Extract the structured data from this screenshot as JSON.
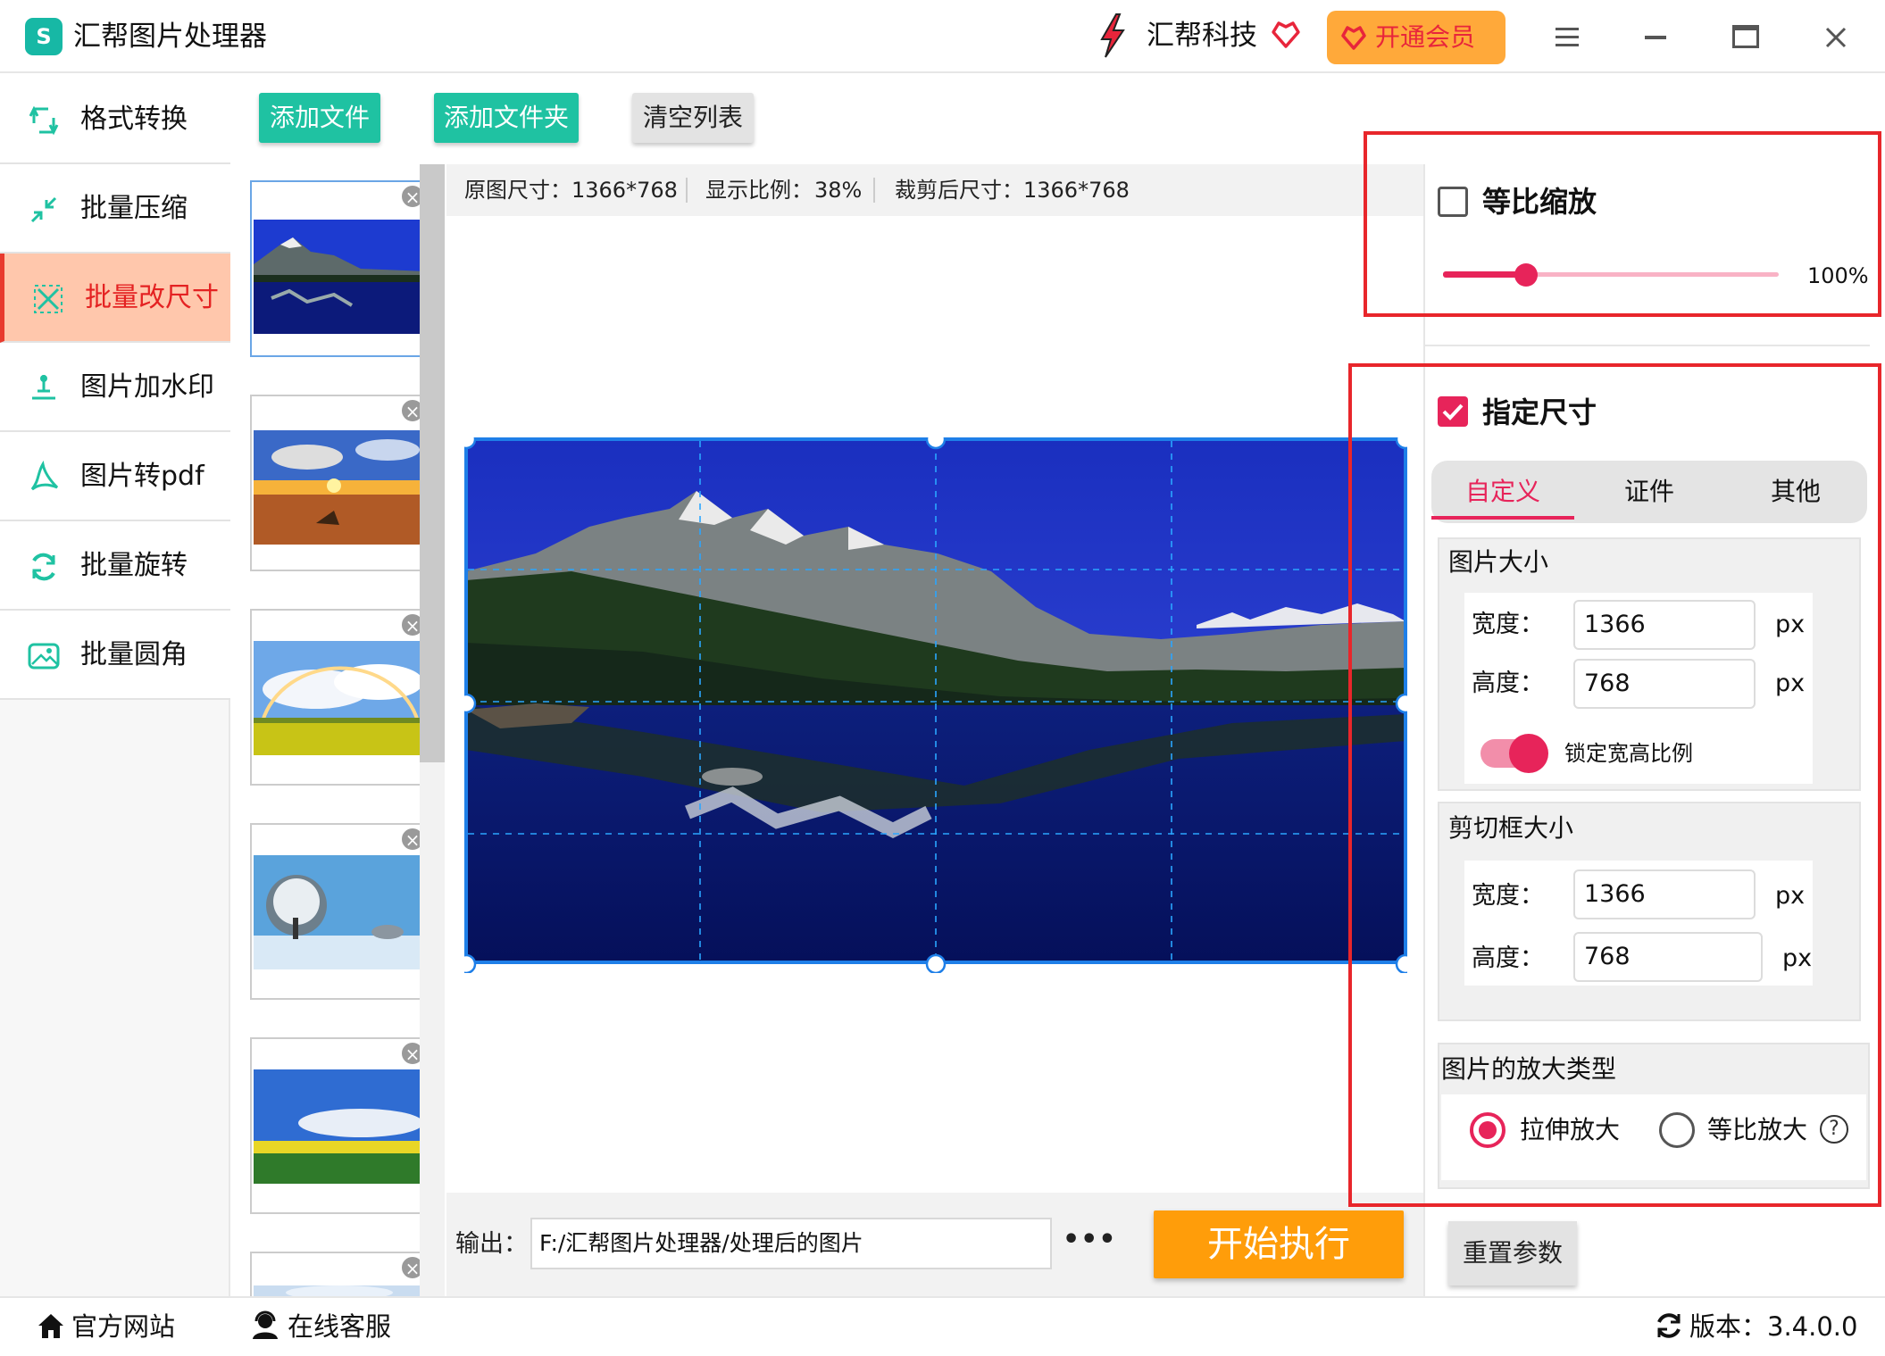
{
  "app": {
    "title": "汇帮图片处理器",
    "logo_text": "S",
    "accent": "#e7245a",
    "green": "#1fc2a2",
    "orange": "#ff9d0a"
  },
  "header": {
    "brand": "汇帮科技",
    "vip_label": "开通会员"
  },
  "sidebar": {
    "items": [
      {
        "label": "格式转换",
        "icon": "format-convert-icon"
      },
      {
        "label": "批量压缩",
        "icon": "compress-icon"
      },
      {
        "label": "批量改尺寸",
        "icon": "resize-icon",
        "active": true
      },
      {
        "label": "图片加水印",
        "icon": "watermark-icon"
      },
      {
        "label": "图片转pdf",
        "icon": "pdf-icon"
      },
      {
        "label": "批量旋转",
        "icon": "rotate-icon"
      },
      {
        "label": "批量圆角",
        "icon": "rounded-corner-icon"
      }
    ]
  },
  "toolbar": {
    "add_file": "添加文件",
    "add_folder": "添加文件夹",
    "clear_list": "清空列表"
  },
  "thumbnails": {
    "remove_glyph": "×",
    "items": [
      {
        "subject": "mountain lake",
        "selected": true
      },
      {
        "subject": "sunset beach"
      },
      {
        "subject": "rainbow over rapeseed field"
      },
      {
        "subject": "snowy trees"
      },
      {
        "subject": "blue sky over yellow field"
      },
      {
        "subject": "sky"
      }
    ]
  },
  "preview": {
    "original_size_label": "原图尺寸：",
    "original_size": "1366*768",
    "display_ratio_label": "显示比例：",
    "display_ratio": "38%",
    "cropped_size_label": "裁剪后尺寸：",
    "cropped_size": "1366*768"
  },
  "output": {
    "label": "输出：",
    "path": "F:/汇帮图片处理器/处理后的图片",
    "more": "•••",
    "start": "开始执行"
  },
  "panel": {
    "proportional": {
      "label": "等比缩放",
      "checked": false,
      "value_label": "100%",
      "value": 0.25
    },
    "specify": {
      "label": "指定尺寸",
      "checked": true
    },
    "tabs": [
      {
        "label": "自定义",
        "active": true
      },
      {
        "label": "证件"
      },
      {
        "label": "其他"
      }
    ],
    "image_size": {
      "title": "图片大小",
      "width_label": "宽度：",
      "width": "1366",
      "height_label": "高度：",
      "height": "768",
      "unit": "px",
      "lock_label": "锁定宽高比例",
      "lock_on": true
    },
    "crop_size": {
      "title": "剪切框大小",
      "width_label": "宽度：",
      "width": "1366",
      "height_label": "高度：",
      "height": "768",
      "unit": "px"
    },
    "enlarge": {
      "title": "图片的放大类型",
      "options": [
        {
          "label": "拉伸放大",
          "selected": true
        },
        {
          "label": "等比放大",
          "selected": false
        }
      ],
      "help_glyph": "?"
    },
    "reset": "重置参数"
  },
  "footer": {
    "website": "官方网站",
    "support": "在线客服",
    "version_label": "版本：",
    "version": "3.4.0.0"
  }
}
